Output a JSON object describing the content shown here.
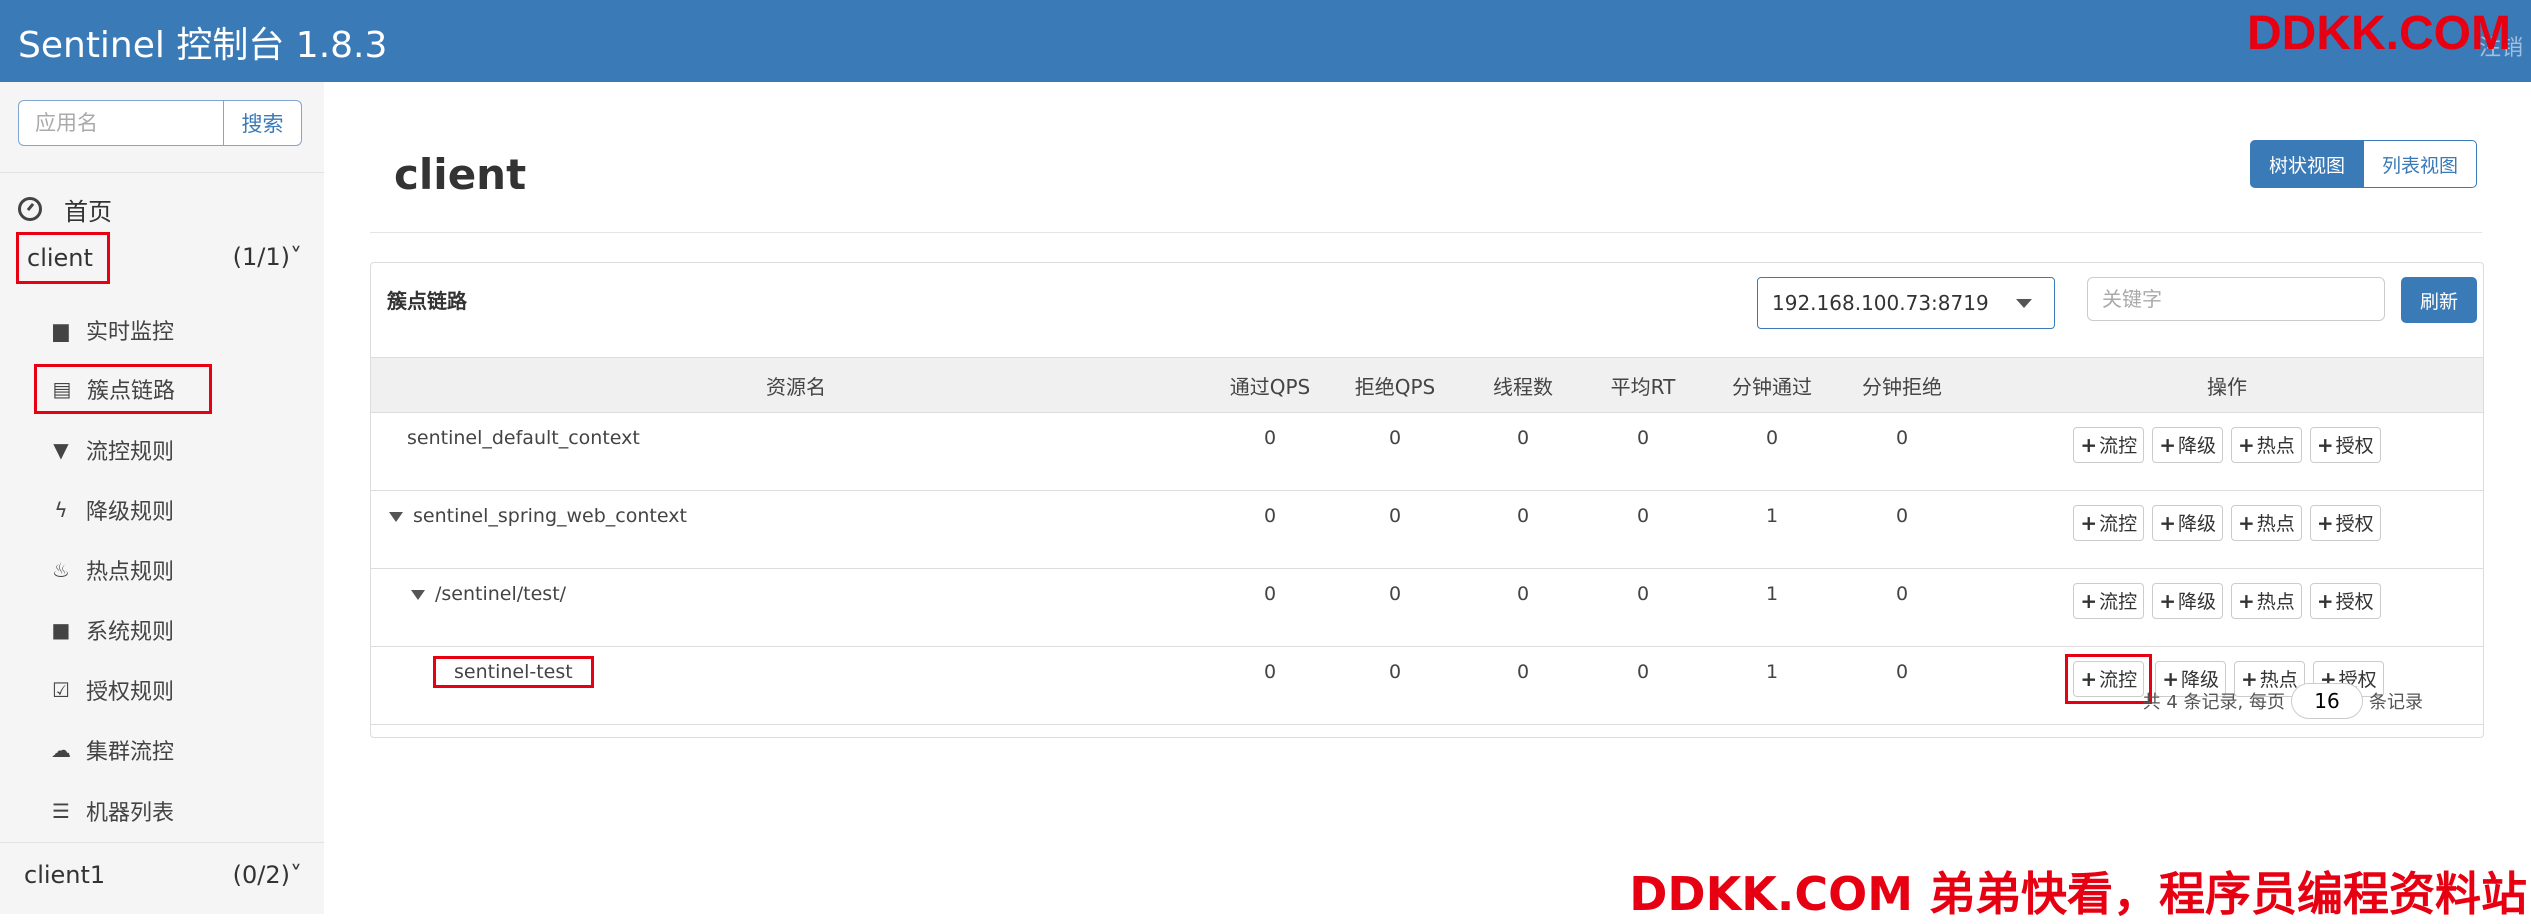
{
  "header": {
    "brand": "Sentinel 控制台 1.8.3",
    "logout": "注销"
  },
  "watermarks": {
    "top": "DDKK.COM",
    "bottom": "DDKK.COM 弟弟快看，程序员编程资料站"
  },
  "sidebar": {
    "search": {
      "placeholder": "应用名",
      "button": "搜索"
    },
    "home": "首页",
    "apps": [
      {
        "name": "client",
        "count": "(1/1)˅"
      },
      {
        "name": "client1",
        "count": "(0/2)˅"
      }
    ],
    "items": [
      {
        "label": "实时监控",
        "icon": "bar-chart-icon"
      },
      {
        "label": "簇点链路",
        "icon": "list-icon"
      },
      {
        "label": "流控规则",
        "icon": "filter-icon"
      },
      {
        "label": "降级规则",
        "icon": "flash-icon"
      },
      {
        "label": "热点规则",
        "icon": "fire-icon"
      },
      {
        "label": "系统规则",
        "icon": "lock-icon"
      },
      {
        "label": "授权规则",
        "icon": "check-icon"
      },
      {
        "label": "集群流控",
        "icon": "cloud-icon"
      },
      {
        "label": "机器列表",
        "icon": "th-list-icon"
      }
    ]
  },
  "main": {
    "title": "client",
    "view_toggle": {
      "tree": "树状视图",
      "list": "列表视图"
    },
    "panel_title": "簇点链路",
    "machine": "192.168.100.73:8719",
    "keyword_placeholder": "关键字",
    "refresh": "刷新",
    "columns": [
      "资源名",
      "通过QPS",
      "拒绝QPS",
      "线程数",
      "平均RT",
      "分钟通过",
      "分钟拒绝",
      "操作"
    ],
    "rows": [
      {
        "name": "sentinel_default_context",
        "values": [
          "0",
          "0",
          "0",
          "0",
          "0",
          "0"
        ]
      },
      {
        "name": "sentinel_spring_web_context",
        "values": [
          "0",
          "0",
          "0",
          "0",
          "1",
          "0"
        ]
      },
      {
        "name": "/sentinel/test/",
        "values": [
          "0",
          "0",
          "0",
          "0",
          "1",
          "0"
        ]
      },
      {
        "name": "sentinel-test",
        "values": [
          "0",
          "0",
          "0",
          "0",
          "1",
          "0"
        ]
      }
    ],
    "ops": {
      "flow": "流控",
      "degrade": "降级",
      "hot": "热点",
      "auth": "授权"
    },
    "pager": {
      "prefix": "共 4 条记录, 每页",
      "size": "16",
      "suffix": "条记录"
    }
  },
  "colors": {
    "accent": "#3a7ab7",
    "highlight": "#e60012"
  }
}
